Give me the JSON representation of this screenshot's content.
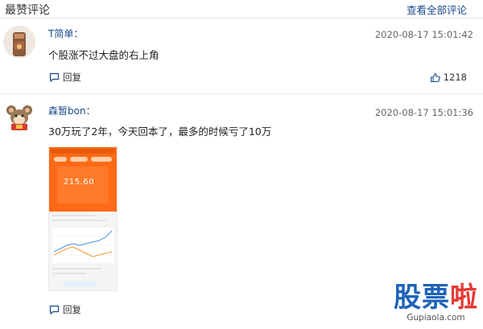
{
  "header": {
    "title": "最赞评论",
    "view_all": "查看全部评论"
  },
  "comments": [
    {
      "username": "T简单：",
      "time": "2020-08-17 15:01:42",
      "text": "个股涨不过大盘的右上角",
      "reply_label": "回复",
      "likes": "1218"
    },
    {
      "username": "森暂bon：",
      "time": "2020-08-17 15:01:36",
      "text": "30万玩了2年，今天回本了，最多的时候亏了10万",
      "reply_label": "回复",
      "screenshot_amount": "215.60"
    }
  ],
  "watermark": {
    "title_chars": [
      "股",
      "票",
      "啦"
    ],
    "url": "Gupiaola.com"
  },
  "colors": {
    "link": "#1a4a8c",
    "orange": "#ff6a16",
    "watermark_blue": "#1d63b8",
    "watermark_red": "#e53935"
  }
}
